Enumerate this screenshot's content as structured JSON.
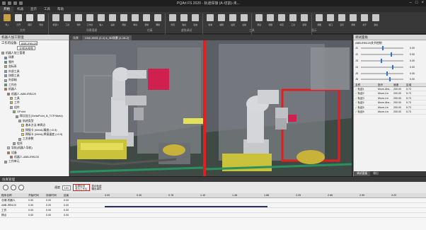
{
  "app": {
    "title": "PQArt FS 2020 - 轨道焊接 (A-切割)-未..."
  },
  "menu": [
    {
      "label": "开始"
    },
    {
      "label": "机器"
    },
    {
      "label": "显示"
    },
    {
      "label": "工具"
    },
    {
      "label": "帮助"
    }
  ],
  "ribbon": {
    "buttons": [
      {
        "label": "导入",
        "color": "#c8a040"
      },
      {
        "label": "打开",
        "color": "#d8d8d8"
      },
      {
        "label": "保存",
        "color": "#d8d8d8"
      },
      {
        "label": "导出",
        "color": "#d8d8d8"
      },
      {
        "label": "机器人",
        "color": "#c8c8c8"
      },
      {
        "label": "工具",
        "color": "#c8c8c8"
      },
      {
        "label": "零件",
        "color": "#c8c8c8"
      },
      {
        "label": "工作台",
        "color": "#c8c8c8"
      },
      {
        "label": "输入",
        "color": "#c8c8c8"
      },
      {
        "label": "设备",
        "color": "#c8c8c8"
      },
      {
        "label": "添加",
        "color": "#c8c8c8"
      },
      {
        "label": "移动",
        "color": "#c8c8c8"
      },
      {
        "label": "复制",
        "color": "#c8c8c8"
      },
      {
        "label": "删除",
        "color": "#c8c8c8"
      },
      {
        "label": "仿真",
        "color": "#c8c8c8"
      },
      {
        "label": "输出",
        "color": "#c8c8c8"
      },
      {
        "label": "轨迹",
        "color": "#c8c8c8"
      },
      {
        "label": "校准",
        "color": "#c8c8c8"
      },
      {
        "label": "编辑",
        "color": "#c8c8c8"
      },
      {
        "label": "后置",
        "color": "#c8c8c8"
      },
      {
        "label": "虚拟",
        "color": "#c8c8c8"
      },
      {
        "label": "调试",
        "color": "#c8c8c8"
      },
      {
        "label": "测量",
        "color": "#c8c8c8"
      },
      {
        "label": "标定",
        "color": "#c8c8c8"
      },
      {
        "label": "工具",
        "color": "#c8c8c8"
      },
      {
        "label": "选项",
        "color": "#c8c8c8"
      },
      {
        "label": "视图",
        "color": "#c8c8c8"
      },
      {
        "label": "窗口",
        "color": "#c8c8c8"
      },
      {
        "label": "显示",
        "color": "#c8c8c8"
      },
      {
        "label": "帮助",
        "color": "#c8c8c8"
      },
      {
        "label": "关于",
        "color": "#c8c8c8"
      },
      {
        "label": "退出",
        "color": "#c8c8c8"
      }
    ],
    "groups": [
      "文件",
      "场景搭建",
      "仿真",
      "虚拟调试",
      "工具",
      "显示"
    ]
  },
  "left_panel": {
    "title": "机器人加工管理",
    "work_device_label": "工作的设备:",
    "work_device_value": "ABB-IRB120",
    "selector_value": "全视选视图",
    "tree": [
      "机器人加工管理",
      "场景",
      "零件",
      "坐标系",
      "外部工具",
      "快换工具",
      "外部轴",
      "工作台",
      "机器人",
      "机器人-ABB-IRB120",
      "工具",
      "工件",
      "组件",
      "GPoint",
      "焊点加工(DeltaPoint_B_TCP/Weld)",
      "轨迹类型",
      "基本方法:单焊点",
      "焊接卡 (Weld)-精度 (<0.5)",
      "焊接卡 (Weld)-焊接速度 (<0.5)",
      "工艺参数",
      "程序",
      "导轨(机器人导轨)",
      "设备",
      "机器人-ABB-IRB120",
      "工作单元"
    ]
  },
  "view_tabs": [
    "场景",
    "CNC-9001 (1-1) k_3D场景 (1-16-2)"
  ],
  "right_panel": {
    "title": "调试面板",
    "robot_label": "ABB-IRB120关节控制",
    "joints": [
      {
        "label": "J1",
        "value": "0.00"
      },
      {
        "label": "J2",
        "value": "0.00"
      },
      {
        "label": "J3",
        "value": "0.00"
      },
      {
        "label": "J4",
        "value": "0.00"
      },
      {
        "label": "J5",
        "value": "0.00"
      },
      {
        "label": "J6",
        "value": "0.00"
      }
    ],
    "table_headers": [
      "名称",
      "指令",
      "速度",
      "区域"
    ],
    "table_rows": [
      {
        "name": "轨迹1",
        "cmd": "Move-Abs...",
        "speed": "200.00",
        "zone": "5.73"
      },
      {
        "name": "轨迹2",
        "cmd": "Move-Lin",
        "speed": "200.00",
        "zone": "5.73"
      },
      {
        "name": "轨迹3",
        "cmd": "Move-Lin",
        "speed": "200.00",
        "zone": "5.73"
      },
      {
        "name": "轨迹4",
        "cmd": "Move-Abs...",
        "speed": "200.00",
        "zone": "5.73"
      },
      {
        "name": "轨迹5",
        "cmd": "Move-Lin",
        "speed": "200.00",
        "zone": "5.73"
      },
      {
        "name": "轨迹6",
        "cmd": "Move-Lin",
        "speed": "200.00",
        "zone": "5.73"
      }
    ],
    "bottom_tabs": [
      "调试面板",
      "输出"
    ]
  },
  "sim_bar": {
    "title": "仿真管理",
    "speed_label": "速度",
    "speed_value": "100",
    "checkbox1": "碰撞检测",
    "checkbox2": "显示工作区",
    "checkbox3": "显示轨迹",
    "checkbox4": "输出事件"
  },
  "timeline": {
    "headers": [
      "程序名称",
      "开始时间",
      "持续时间",
      "结束"
    ],
    "ticks": [
      "0.00",
      "0.40",
      "0.78",
      "1.10",
      "1.46",
      "1.88",
      "2.25",
      "2.66",
      "2.99",
      "3.22"
    ],
    "rows": [
      {
        "name": "仓储-机器人",
        "start": "0.00",
        "dur": "0.00",
        "end": "0.00"
      },
      {
        "name": "ABB-IRB120",
        "start": "0.00",
        "dur": "0.00",
        "end": "0.00"
      },
      {
        "name": "工件",
        "start": "0.00",
        "dur": "0.00",
        "end": "0.00"
      },
      {
        "name": "焊点",
        "start": "0.00",
        "dur": "0.00",
        "end": "0.00"
      }
    ]
  }
}
